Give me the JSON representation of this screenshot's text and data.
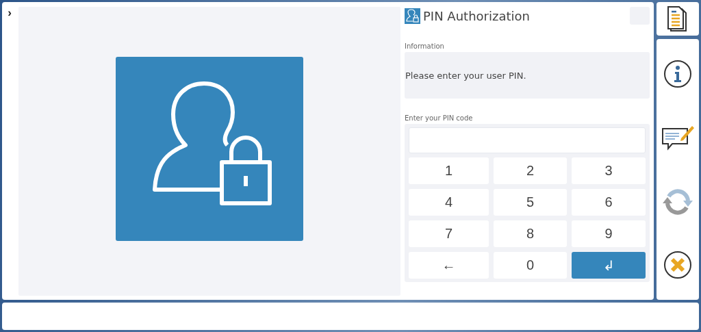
{
  "expand_toggle": "›",
  "dialog": {
    "title": "PIN Authorization",
    "information": {
      "label": "Information",
      "message": "Please enter your user PIN."
    },
    "pin": {
      "label": "Enter your PIN code",
      "keys": [
        {
          "label": "1",
          "kind": "digit"
        },
        {
          "label": "2",
          "kind": "digit"
        },
        {
          "label": "3",
          "kind": "digit"
        },
        {
          "label": "4",
          "kind": "digit"
        },
        {
          "label": "5",
          "kind": "digit"
        },
        {
          "label": "6",
          "kind": "digit"
        },
        {
          "label": "7",
          "kind": "digit"
        },
        {
          "label": "8",
          "kind": "digit"
        },
        {
          "label": "9",
          "kind": "digit"
        },
        {
          "label": "←",
          "kind": "digit"
        },
        {
          "label": "0",
          "kind": "digit"
        },
        {
          "label": "↲",
          "kind": "enter"
        }
      ]
    }
  },
  "sidebar": {
    "top": {
      "kind": "document"
    },
    "items": [
      {
        "kind": "info"
      },
      {
        "kind": "note"
      },
      {
        "kind": "refresh"
      },
      {
        "kind": "cancel"
      }
    ]
  }
}
